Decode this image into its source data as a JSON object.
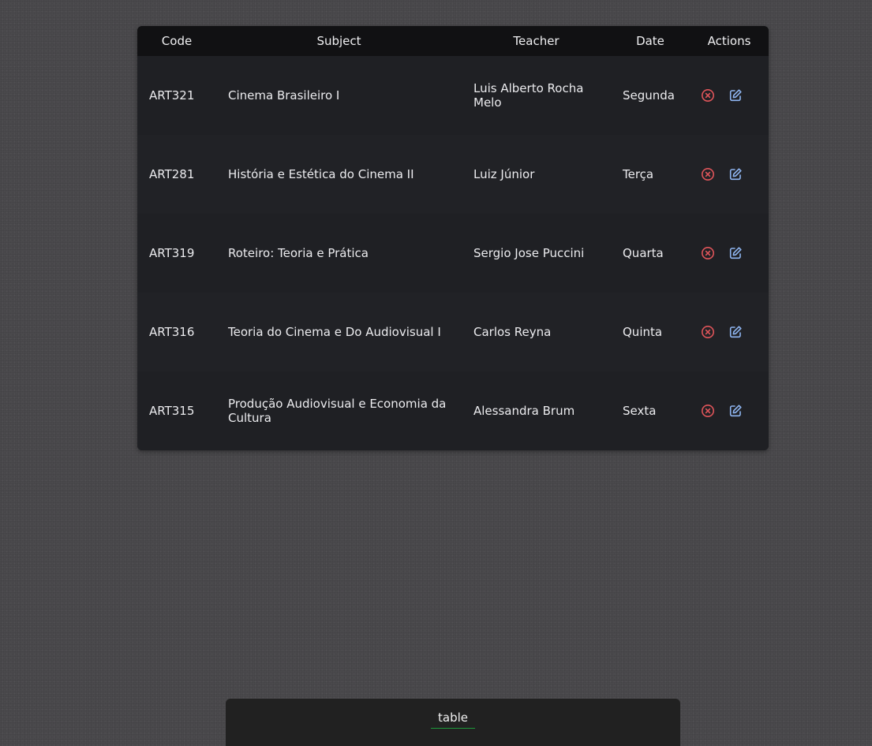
{
  "table": {
    "headers": {
      "code": "Code",
      "subject": "Subject",
      "teacher": "Teacher",
      "date": "Date",
      "actions": "Actions"
    },
    "rows": [
      {
        "code": "ART321",
        "subject": "Cinema Brasileiro I",
        "teacher": "Luis Alberto Rocha Melo",
        "date": "Segunda"
      },
      {
        "code": "ART281",
        "subject": "História e Estética do Cinema II",
        "teacher": "Luiz Júnior",
        "date": "Terça"
      },
      {
        "code": "ART319",
        "subject": "Roteiro: Teoria e Prática",
        "teacher": "Sergio Jose Puccini",
        "date": "Quarta"
      },
      {
        "code": "ART316",
        "subject": "Teoria do Cinema e Do Audiovisual I",
        "teacher": "Carlos Reyna",
        "date": "Quinta"
      },
      {
        "code": "ART315",
        "subject": "Produção Audiovisual e Economia da Cultura",
        "teacher": "Alessandra Brum",
        "date": "Sexta"
      }
    ],
    "row_actions": [
      {
        "icon": "delete-circle-x-icon",
        "color": "#e0555a"
      },
      {
        "icon": "edit-pencil-icon",
        "color": "#8fb6f2"
      }
    ]
  },
  "bottom_nav": {
    "tab_label": "table",
    "active_underline_color": "#1e9b3a"
  },
  "colors": {
    "page_background": "#4a494c",
    "table_background": "#1f2024",
    "header_background": "#111113"
  }
}
